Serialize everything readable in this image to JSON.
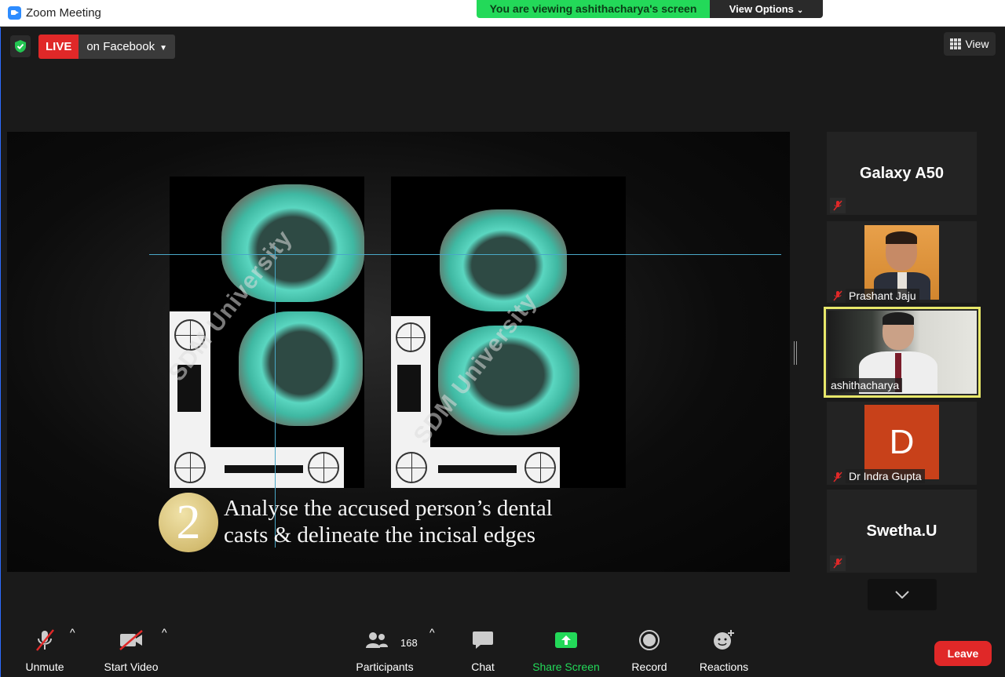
{
  "window": {
    "title": "Zoom Meeting"
  },
  "banner": {
    "viewing_text": "You are viewing ashithacharya's screen",
    "view_options_label": "View Options"
  },
  "top_controls": {
    "live_label": "LIVE",
    "stream_target": "on Facebook",
    "view_label": "View"
  },
  "slide": {
    "step_number": "2",
    "caption_line1": "Analyse the accused person’s dental",
    "caption_line2": "casts & delineate the incisal edges",
    "watermark": "SDM University"
  },
  "participants": [
    {
      "name": "Galaxy A50",
      "muted": true,
      "video": false
    },
    {
      "name": "Prashant Jaju",
      "muted": true,
      "video": true
    },
    {
      "name": "ashithacharya",
      "muted": false,
      "video": true,
      "active_speaker": true
    },
    {
      "name": "Dr Indra Gupta",
      "muted": true,
      "video": false,
      "initial": "D"
    },
    {
      "name": "Swetha.U",
      "muted": true,
      "video": false
    }
  ],
  "toolbar": {
    "unmute_label": "Unmute",
    "start_video_label": "Start Video",
    "participants_label": "Participants",
    "participants_count": "168",
    "chat_label": "Chat",
    "share_screen_label": "Share Screen",
    "record_label": "Record",
    "reactions_label": "Reactions",
    "leave_label": "Leave"
  },
  "colors": {
    "live": "#e02828",
    "share": "#23d959",
    "active_border": "#e8e86a",
    "leave": "#e02828"
  }
}
